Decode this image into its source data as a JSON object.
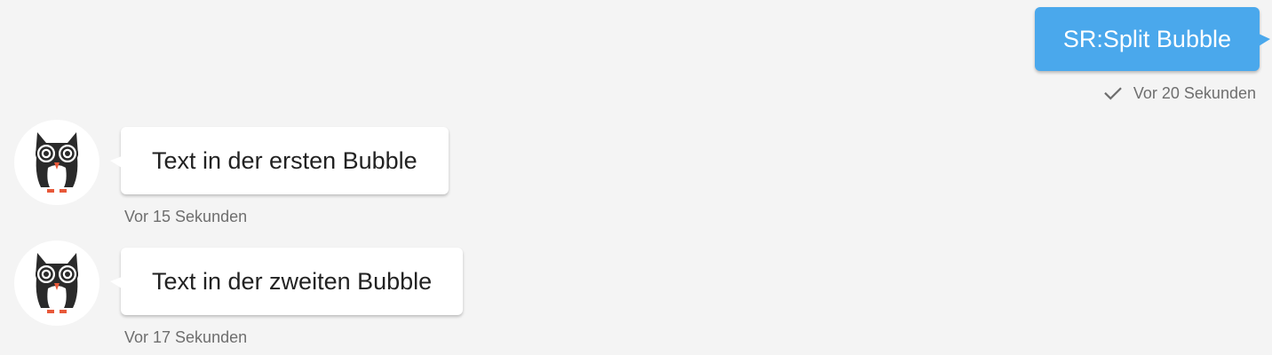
{
  "outgoing": {
    "text": "SR:Split Bubble",
    "timestamp": "Vor 20 Sekunden",
    "status_icon": "check-icon",
    "bubble_color": "#4aa8ec"
  },
  "incoming": [
    {
      "text": "Text in der ersten Bubble",
      "timestamp": "Vor 15 Sekunden",
      "avatar_icon": "owl-avatar-icon"
    },
    {
      "text": "Text in der zweiten Bubble",
      "timestamp": "Vor 17 Sekunden",
      "avatar_icon": "owl-avatar-icon"
    }
  ],
  "colors": {
    "background": "#f4f4f4",
    "bubble_in": "#ffffff",
    "meta_text": "#6e6e6e",
    "owl_accent": "#e8593a"
  }
}
